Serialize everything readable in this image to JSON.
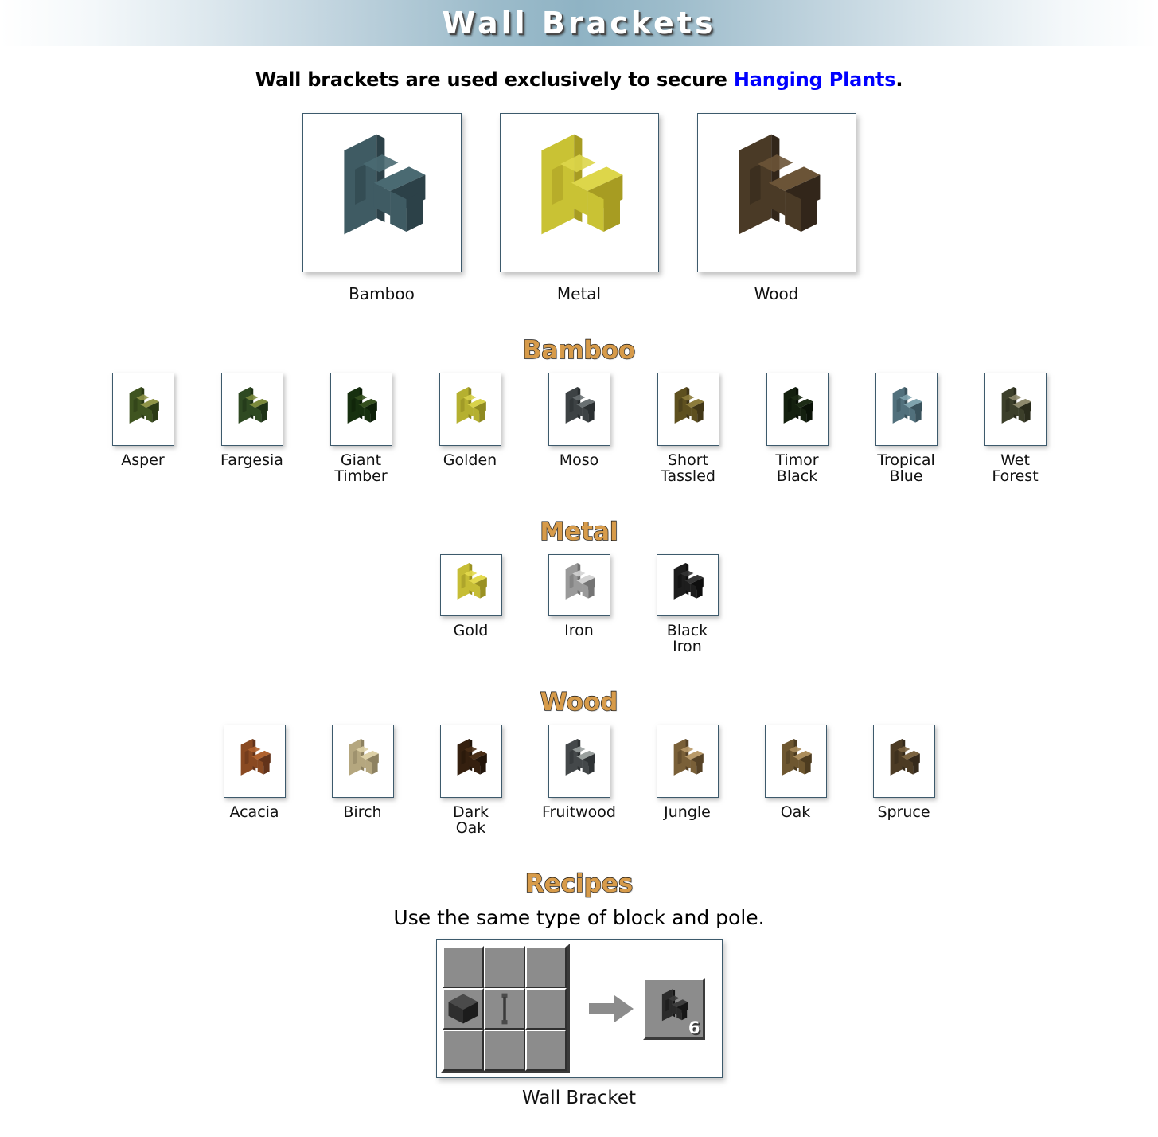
{
  "banner": {
    "title": "Wall Brackets"
  },
  "intro": {
    "before": "Wall brackets are used exclusively to secure ",
    "link": "Hanging Plants",
    "after": "."
  },
  "categories": [
    {
      "label": "Bamboo",
      "icon": "wall-bracket-bamboo-icon",
      "plate": "#3f5b63",
      "arm": "#4a6a72",
      "edge": "#2c4148"
    },
    {
      "label": "Metal",
      "icon": "wall-bracket-metal-icon",
      "plate": "#c9c234",
      "arm": "#ddd64a",
      "edge": "#a79c22"
    },
    {
      "label": "Wood",
      "icon": "wall-bracket-wood-icon",
      "plate": "#4a3a26",
      "arm": "#6b5437",
      "edge": "#32261a"
    }
  ],
  "sections": [
    {
      "heading": "Bamboo",
      "tall": true,
      "items": [
        {
          "label": "Asper",
          "plate": "#3f5420",
          "arm": "#8f9447",
          "edge": "#2b3a15"
        },
        {
          "label": "Fargesia",
          "plate": "#2f4a22",
          "arm": "#7b8a3c",
          "edge": "#1e3216"
        },
        {
          "label": "Giant\nTimber",
          "plate": "#17300f",
          "arm": "#35501f",
          "edge": "#0d1f08"
        },
        {
          "label": "Golden",
          "plate": "#b5b030",
          "arm": "#d8d24a",
          "edge": "#8f8a20"
        },
        {
          "label": "Moso",
          "plate": "#3d4244",
          "arm": "#697072",
          "edge": "#2a2f31"
        },
        {
          "label": "Short\nTassled",
          "plate": "#5e501f",
          "arm": "#8d7c3c",
          "edge": "#423717"
        },
        {
          "label": "Timor\nBlack",
          "plate": "#14200f",
          "arm": "#1d2c16",
          "edge": "#0a1207"
        },
        {
          "label": "Tropical\nBlue",
          "plate": "#51707c",
          "arm": "#7fa3ae",
          "edge": "#3a535d"
        },
        {
          "label": "Wet\nForest",
          "plate": "#3c3f2a",
          "arm": "#8e8a6d",
          "edge": "#2a2c1c"
        }
      ]
    },
    {
      "heading": "Metal",
      "tall": false,
      "items": [
        {
          "label": "Gold",
          "plate": "#c6bd35",
          "arm": "#e3d94d",
          "edge": "#9a9122"
        },
        {
          "label": "Iron",
          "plate": "#9a9a9a",
          "arm": "#d3d3d3",
          "edge": "#747474"
        },
        {
          "label": "Black Iron",
          "plate": "#1d1d1d",
          "arm": "#343434",
          "edge": "#0e0e0e"
        }
      ]
    },
    {
      "heading": "Wood",
      "tall": true,
      "items": [
        {
          "label": "Acacia",
          "plate": "#8a4a22",
          "arm": "#b0622e",
          "edge": "#63331a"
        },
        {
          "label": "Birch",
          "plate": "#b5a77f",
          "arm": "#ddd0a6",
          "edge": "#8d8160"
        },
        {
          "label": "Dark Oak",
          "plate": "#35200f",
          "arm": "#4a2f17",
          "edge": "#22150a"
        },
        {
          "label": "Fruitwood",
          "plate": "#44484a",
          "arm": "#9aa09e",
          "edge": "#2f3335"
        },
        {
          "label": "Jungle",
          "plate": "#7a6038",
          "arm": "#b99a69",
          "edge": "#564226"
        },
        {
          "label": "Oak",
          "plate": "#6e5730",
          "arm": "#ab8d5c",
          "edge": "#4d3c20"
        },
        {
          "label": "Spruce",
          "plate": "#4c3b24",
          "arm": "#7b6340",
          "edge": "#35291a"
        }
      ]
    }
  ],
  "recipes": {
    "heading": "Recipes",
    "subtitle": "Use the same type of block and pole.",
    "grid": [
      [
        "",
        "",
        ""
      ],
      [
        "block",
        "pole",
        ""
      ],
      [
        "",
        "",
        ""
      ]
    ],
    "arrow_icon": "arrow-right-icon",
    "output": {
      "label": "Wall Bracket",
      "count": "6",
      "icon": "wall-bracket-output-icon"
    }
  },
  "colors": {
    "banner_center": "#8fb3c4",
    "tile_border": "#3d5a6c",
    "section_heading": "#d79b4a",
    "link": "#0000ff",
    "slot_gray": "#8c8c8c"
  }
}
